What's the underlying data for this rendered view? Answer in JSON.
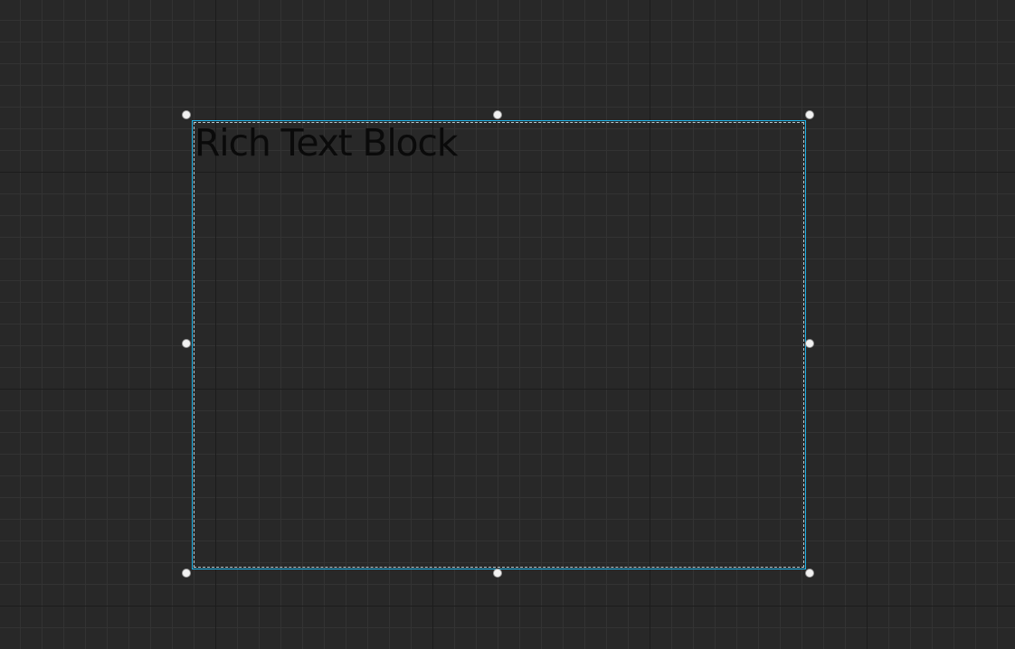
{
  "widget": {
    "text": "Rich Text Block",
    "selection_color": "#1fb5ea"
  }
}
